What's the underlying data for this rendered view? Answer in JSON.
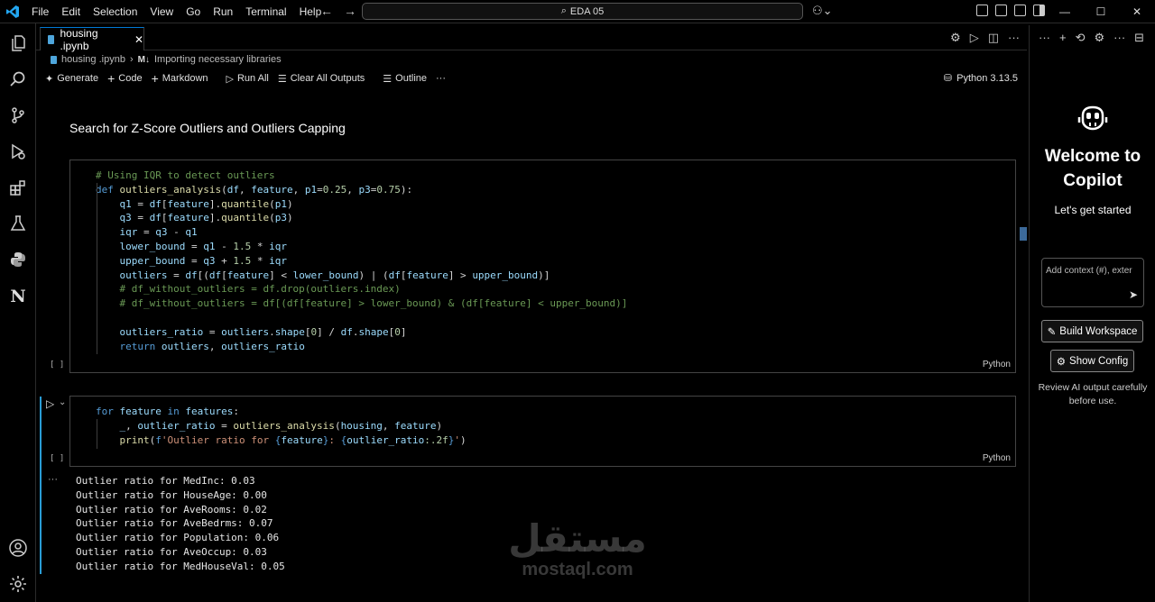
{
  "menu": [
    "File",
    "Edit",
    "Selection",
    "View",
    "Go",
    "Run",
    "Terminal",
    "Help"
  ],
  "search": {
    "text": "EDA 05"
  },
  "tab": {
    "label": "housing .ipynb"
  },
  "breadcrumb": {
    "file": "housing .ipynb",
    "section_badge": "M↓",
    "section": "Importing necessary libraries"
  },
  "toolbar": {
    "generate": "Generate",
    "code": "Code",
    "markdown": "Markdown",
    "run_all": "Run All",
    "clear_outputs": "Clear All Outputs",
    "outline": "Outline",
    "more": "···",
    "kernel": "Python 3.13.5"
  },
  "markdown_cell": {
    "heading": "Search for Z-Score Outliers and Outliers Capping"
  },
  "cell1": {
    "exec": "[ ]",
    "lang": "Python"
  },
  "cell2": {
    "exec": "[ ]",
    "lang": "Python"
  },
  "output": {
    "menu": "···",
    "lines": [
      "Outlier ratio for MedInc: 0.03",
      "Outlier ratio for HouseAge: 0.00",
      "Outlier ratio for AveRooms: 0.02",
      "Outlier ratio for AveBedrms: 0.07",
      "Outlier ratio for Population: 0.06",
      "Outlier ratio for AveOccup: 0.03",
      "Outlier ratio for MedHouseVal: 0.05"
    ]
  },
  "copilot": {
    "welcome_line1": "Welcome to",
    "welcome_line2": "Copilot",
    "subtitle": "Let's get started",
    "input_placeholder": "Add context (#), exter",
    "build_workspace": "Build Workspace",
    "show_config": "Show Config",
    "review_line1": "Review AI output carefully",
    "review_line2": "before use."
  },
  "watermark": {
    "arabic": "مستقل",
    "latin": "mostaql.com"
  },
  "colors": {
    "accent": "#0078d4",
    "keyword": "#569cd6",
    "function": "#dcdcaa",
    "variable": "#9cdcfe",
    "number": "#b5cea8",
    "comment": "#6a9955",
    "string": "#ce9178"
  }
}
